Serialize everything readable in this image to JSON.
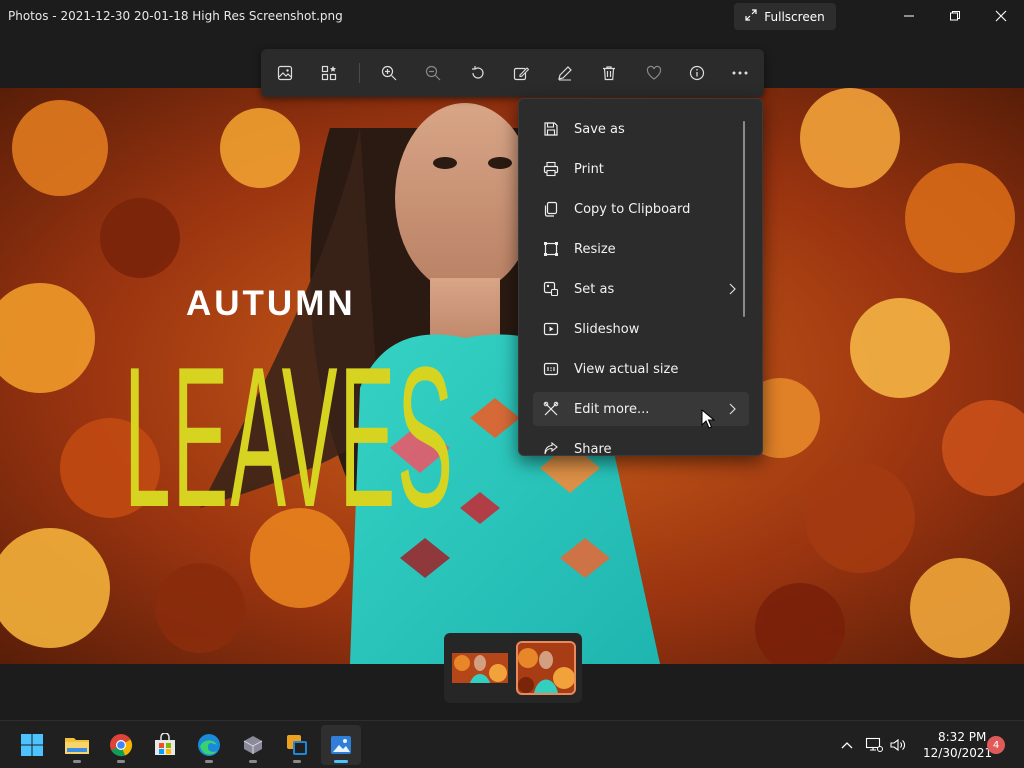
{
  "window": {
    "title": "Photos - 2021-12-30 20-01-18 High Res Screenshot.png",
    "fullscreen_label": "Fullscreen"
  },
  "image": {
    "headline_small": "AUTUMN",
    "headline_large": "LEAVES"
  },
  "toolbar": {
    "buttons": [
      "gallery-icon",
      "view-all-icon",
      "zoom-in-icon",
      "zoom-out-icon",
      "rotate-icon",
      "edit-image-icon",
      "draw-icon",
      "delete-icon",
      "favorite-icon",
      "info-icon",
      "more-options-icon"
    ]
  },
  "menu": {
    "items": [
      {
        "label": "Save as",
        "icon": "save-icon"
      },
      {
        "label": "Print",
        "icon": "printer-icon"
      },
      {
        "label": "Copy to Clipboard",
        "icon": "copy-icon"
      },
      {
        "label": "Resize",
        "icon": "resize-icon"
      },
      {
        "label": "Set as",
        "icon": "set-as-icon"
      },
      {
        "label": "Slideshow",
        "icon": "slideshow-icon"
      },
      {
        "label": "View actual size",
        "icon": "actual-size-icon"
      },
      {
        "label": "Edit more...",
        "icon": "edit-more-icon"
      },
      {
        "label": "Share",
        "icon": "share-icon"
      }
    ]
  },
  "taskbar": {
    "apps": [
      "windows-start-icon",
      "file-explorer-icon",
      "chrome-icon",
      "microsoft-store-icon",
      "edge-icon",
      "app-icon",
      "app-icon",
      "photos-icon"
    ],
    "time": "8:32 PM",
    "date": "12/30/2021",
    "notification_count": "4"
  },
  "colors": {
    "accent": "#4cc2ff",
    "selection": "#e88a5a",
    "menu_bg": "#2c2c2c",
    "toolbar_bg": "#2b2b2b"
  }
}
